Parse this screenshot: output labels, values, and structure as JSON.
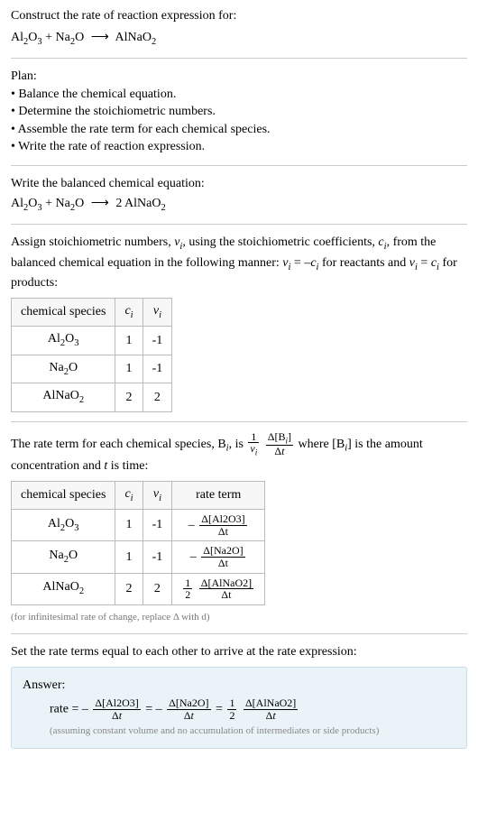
{
  "header": {
    "prompt": "Construct the rate of reaction expression for:"
  },
  "plan": {
    "title": "Plan:",
    "items": [
      "Balance the chemical equation.",
      "Determine the stoichiometric numbers.",
      "Assemble the rate term for each chemical species.",
      "Write the rate of reaction expression."
    ]
  },
  "balanced": {
    "title": "Write the balanced chemical equation:"
  },
  "assign": {
    "title_part1": "Assign stoichiometric numbers, ",
    "title_part2": ", using the stoichiometric coefficients, ",
    "title_part3": ", from the balanced chemical equation in the following manner: ",
    "title_part4": " for reactants and ",
    "title_part5": " for products:"
  },
  "table1": {
    "headers": [
      "chemical species",
      "c_i",
      "ν_i"
    ],
    "rows": [
      {
        "species_html": "Al<sub>2</sub>O<sub>3</sub>",
        "c": "1",
        "nu": "-1"
      },
      {
        "species_html": "Na<sub>2</sub>O",
        "c": "1",
        "nu": "-1"
      },
      {
        "species_html": "AlNaO<sub>2</sub>",
        "c": "2",
        "nu": "2"
      }
    ]
  },
  "rateterm": {
    "part1": "The rate term for each chemical species, B",
    "part2": ", is ",
    "part3": " where [B",
    "part4": "] is the amount concentration and ",
    "part5": " is time:"
  },
  "table2": {
    "headers": [
      "chemical species",
      "c_i",
      "ν_i",
      "rate term"
    ],
    "rows": [
      {
        "species_html": "Al<sub>2</sub>O<sub>3</sub>",
        "c": "1",
        "nu": "-1",
        "rate_num": "Δ[Al2O3]",
        "rate_den": "Δt",
        "sign": "-",
        "coef_num": "",
        "coef_den": ""
      },
      {
        "species_html": "Na<sub>2</sub>O",
        "c": "1",
        "nu": "-1",
        "rate_num": "Δ[Na2O]",
        "rate_den": "Δt",
        "sign": "-",
        "coef_num": "",
        "coef_den": ""
      },
      {
        "species_html": "AlNaO<sub>2</sub>",
        "c": "2",
        "nu": "2",
        "rate_num": "Δ[AlNaO2]",
        "rate_den": "Δt",
        "sign": "",
        "coef_num": "1",
        "coef_den": "2"
      }
    ]
  },
  "table2_note": "(for infinitesimal rate of change, replace Δ with d)",
  "setequal": {
    "text": "Set the rate terms equal to each other to arrive at the rate expression:"
  },
  "answer": {
    "label": "Answer:",
    "note": "(assuming constant volume and no accumulation of intermediates or side products)"
  },
  "chart_data": {
    "type": "table",
    "title": "Stoichiometric numbers and rate terms for Al2O3 + Na2O -> 2 AlNaO2",
    "reaction_unbalanced": "Al2O3 + Na2O -> AlNaO2",
    "reaction_balanced": "Al2O3 + Na2O -> 2 AlNaO2",
    "species": [
      "Al2O3",
      "Na2O",
      "AlNaO2"
    ],
    "c_i": [
      1,
      1,
      2
    ],
    "nu_i": [
      -1,
      -1,
      2
    ],
    "rate_terms": [
      "-(Δ[Al2O3]/Δt)",
      "-(Δ[Na2O]/Δt)",
      "(1/2)(Δ[AlNaO2]/Δt)"
    ],
    "rate_expression": "rate = -(Δ[Al2O3]/Δt) = -(Δ[Na2O]/Δt) = (1/2)(Δ[AlNaO2]/Δt)"
  }
}
